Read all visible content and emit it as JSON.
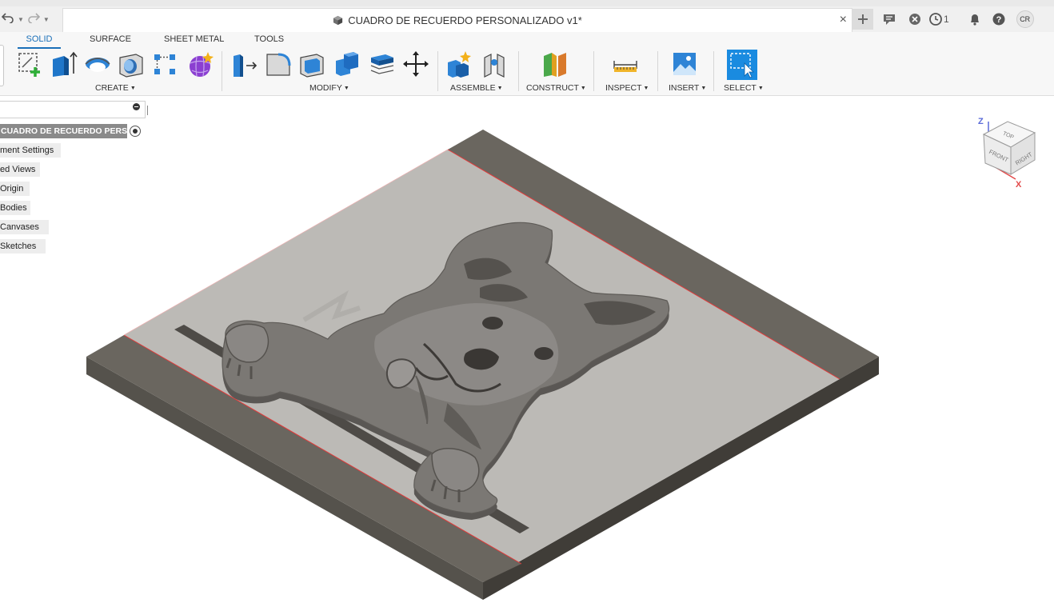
{
  "window": {
    "document_title": "CUADRO DE RECUERDO PERSONALIZADO v1*",
    "close_glyph": "×",
    "user_initials": "CR",
    "job_count": "1",
    "undo_icon": "undo-arrow-icon",
    "redo_icon": "redo-arrow-icon"
  },
  "ribbon": {
    "tabs": [
      {
        "label": "SOLID",
        "active": true
      },
      {
        "label": "SURFACE",
        "active": false
      },
      {
        "label": "SHEET METAL",
        "active": false
      },
      {
        "label": "TOOLS",
        "active": false
      }
    ],
    "groups": {
      "create": "CREATE",
      "modify": "MODIFY",
      "assemble": "ASSEMBLE",
      "construct": "CONSTRUCT",
      "inspect": "INSPECT",
      "insert": "INSERT",
      "select": "SELECT"
    },
    "dropdown_glyph": "▼"
  },
  "browser": {
    "root": "CUADRO DE RECUERDO PERSO...",
    "nodes": [
      "Document Settings",
      "Named Views",
      "Origin",
      "Bodies",
      "Canvases",
      "Sketches"
    ],
    "visible_nodes": [
      "ment Settings",
      "ed Views",
      "Origin",
      "Bodies",
      "Canvases",
      "Sketches"
    ]
  },
  "viewcube": {
    "top": "TOP",
    "front": "FRONT",
    "right": "RIGHT",
    "z": "Z",
    "x": "X"
  },
  "colors": {
    "accent": "#1a6fb8",
    "plate_top": "#bdbbb7",
    "plate_side": "#5d5a54",
    "border_strip": "#6a665f",
    "relief": "#7a7773",
    "edge_red": "#e23a3a"
  }
}
